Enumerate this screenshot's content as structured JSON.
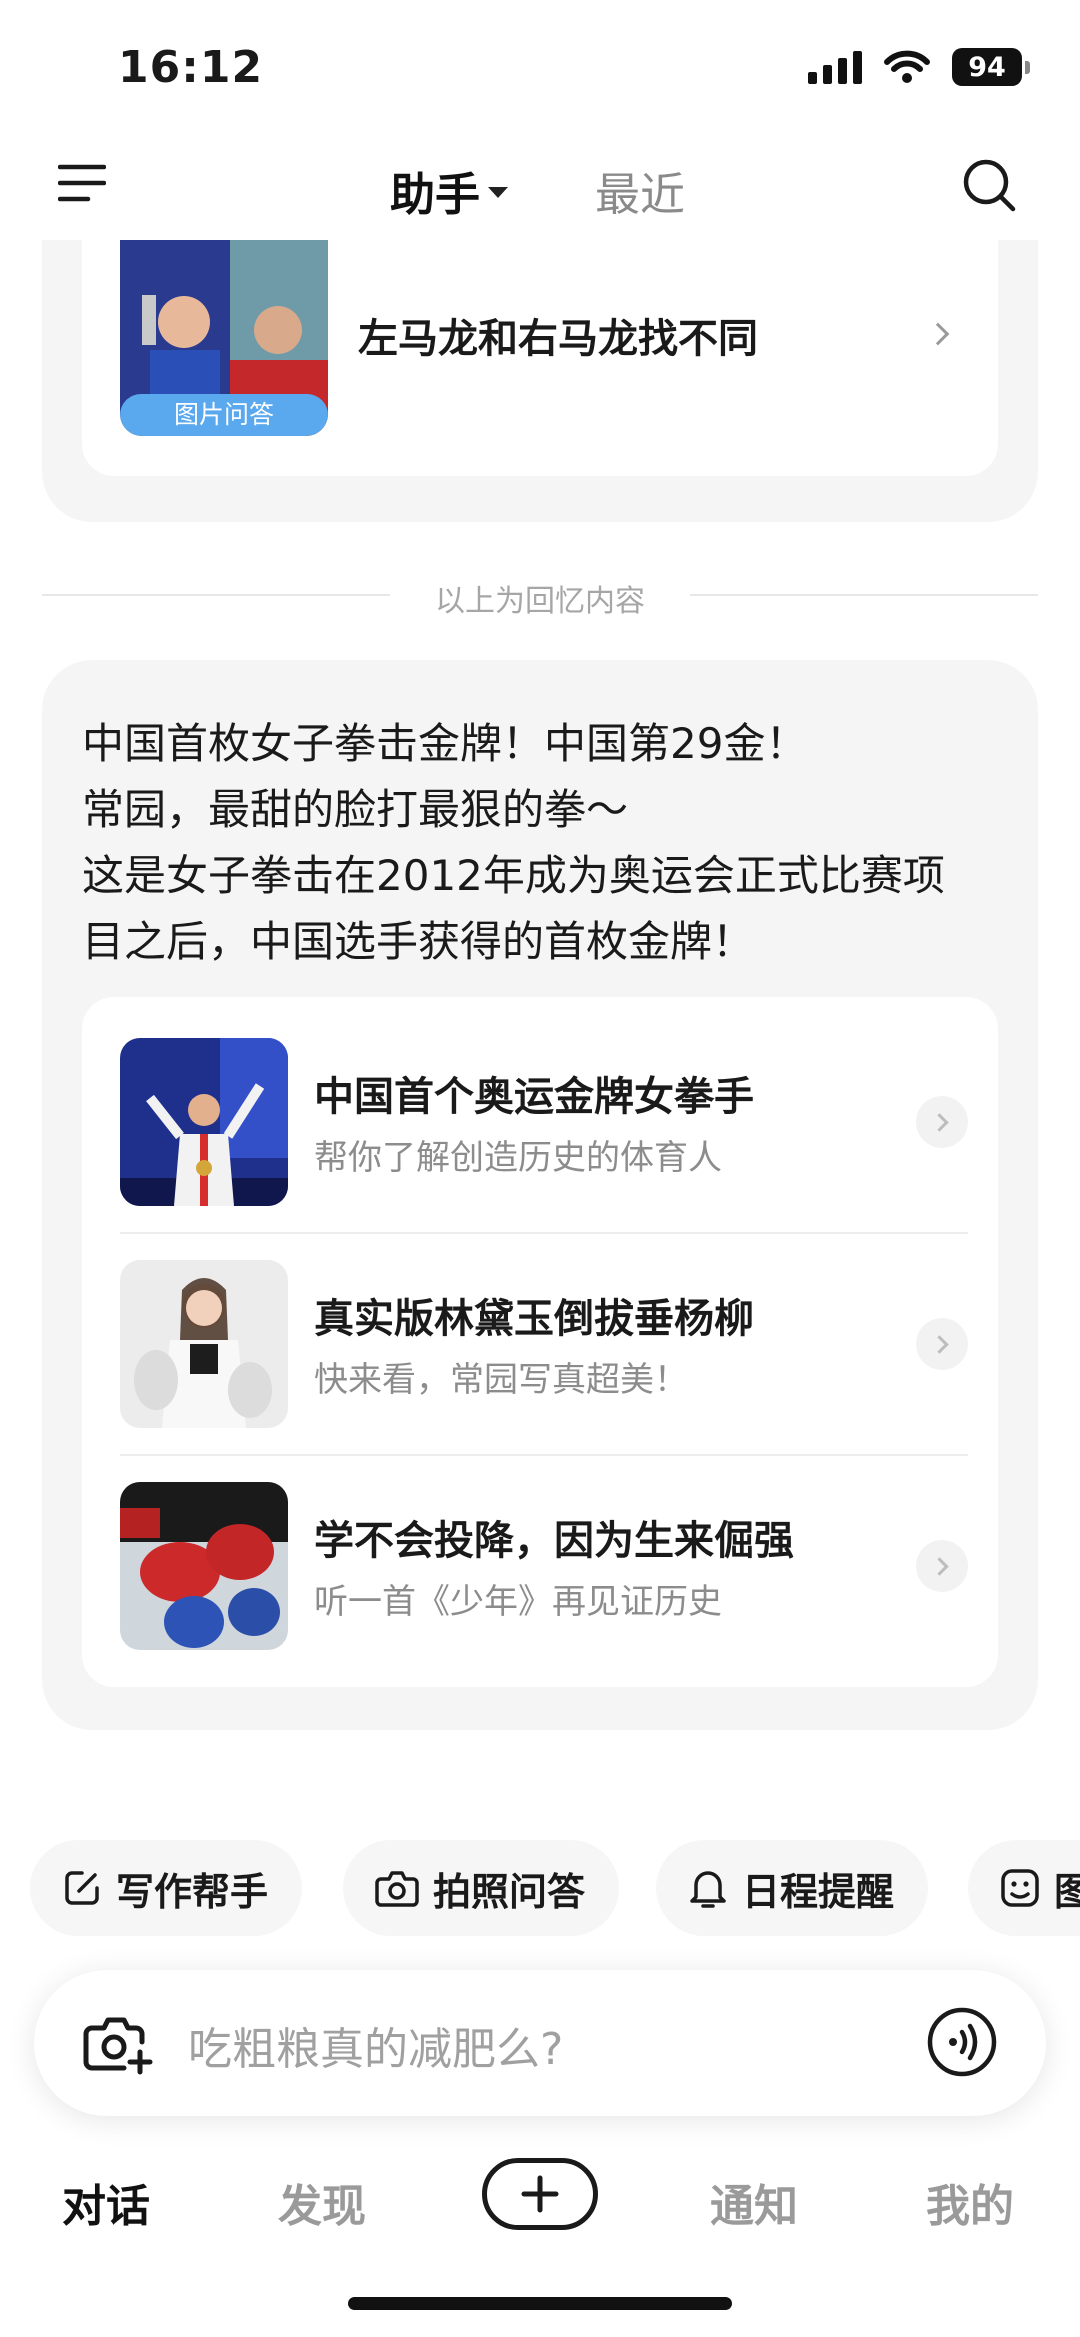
{
  "status_bar": {
    "time": "16:12",
    "battery": "94"
  },
  "header": {
    "tab_assistant": "助手",
    "tab_recent": "最近"
  },
  "memory_card": {
    "title": "左马龙和右马龙找不同",
    "badge": "图片问答"
  },
  "divider_text": "以上为回忆内容",
  "message": {
    "lines": [
      "中国首枚女子拳击金牌！中国第29金！",
      "常园，最甜的脸打最狠的拳～",
      "这是女子拳击在2012年成为奥运会正式比赛项",
      "目之后，中国选手获得的首枚金牌！"
    ],
    "links": [
      {
        "title": "中国首个奥运金牌女拳手",
        "subtitle": "帮你了解创造历史的体育人"
      },
      {
        "title": "真实版林黛玉倒拔垂杨柳",
        "subtitle": "快来看，常园写真超美！"
      },
      {
        "title": "学不会投降，因为生来倔强",
        "subtitle": "听一首《少年》再见证历史"
      }
    ]
  },
  "quick_actions": [
    {
      "label": "写作帮手",
      "icon": "edit-icon"
    },
    {
      "label": "拍照问答",
      "icon": "camera-icon"
    },
    {
      "label": "日程提醒",
      "icon": "bell-icon"
    },
    {
      "label": "图",
      "icon": "image-icon"
    }
  ],
  "input": {
    "placeholder": "吃粗粮真的减肥么?"
  },
  "bottom_nav": {
    "chat": "对话",
    "discover": "发现",
    "notify": "通知",
    "mine": "我的"
  },
  "colors": {
    "card_bg": "#f5f5f5",
    "badge_blue": "#5aa8ee",
    "muted_text": "#8c8c8c"
  }
}
